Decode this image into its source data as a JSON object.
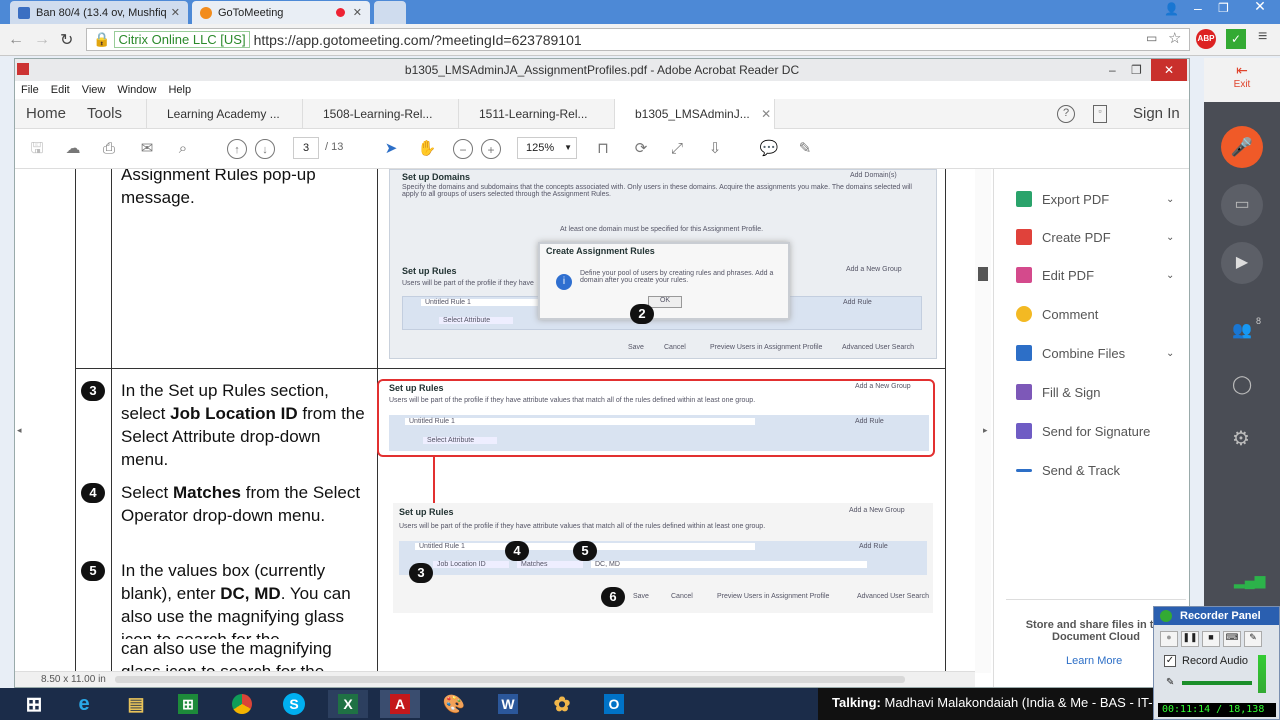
{
  "browser": {
    "tabs": [
      {
        "label": "Ban 80/4 (13.4 ov, Mushfiq"
      },
      {
        "label": "GoToMeeting"
      }
    ],
    "security_label": "Citrix Online LLC [US]",
    "url": "https://app.gotomeeting.com/?meetingId=623789101"
  },
  "acrobat": {
    "window_title": "b1305_LMSAdminJA_AssignmentProfiles.pdf - Adobe Acrobat Reader DC",
    "menu": [
      "File",
      "Edit",
      "View",
      "Window",
      "Help"
    ],
    "home_label": "Home",
    "tools_label": "Tools",
    "tabs": [
      "Learning Academy ...",
      "1508-Learning-Rel...",
      "1511-Learning-Rel...",
      "b1305_LMSAdminJ..."
    ],
    "sign_in": "Sign In",
    "page_current": "3",
    "page_total": "/ 13",
    "zoom": "125%",
    "page_size": "8.50 x 11.00 in"
  },
  "document": {
    "intro_text": "Assignment Rules pop-up message.",
    "step3_num": "3",
    "step3_a": "In the Set up Rules section, select ",
    "step3_b": "Job Location ID",
    "step3_c": " from the Select Attribute drop-down menu.",
    "step4_num": "4",
    "step4_a": "Select ",
    "step4_b": "Matches",
    "step4_c": " from the Select Operator drop-down menu.",
    "step5_num": "5",
    "step5_a": "In the values box (currently blank), enter ",
    "step5_b": "DC, MD",
    "step5_c": ". You can also use the magnifying glass icon to search for the",
    "step5_repeat": "can also use the magnifying glass icon to search for the",
    "shot1": {
      "domains_hdr": "Set up Domains",
      "add_domains": "Add Domain(s)",
      "domains_desc": "Specify the domains and subdomains that the concepts associated with. Only users in these domains. Acquire the assignments you make. The domains selected will apply to all groups of users selected through the Assignment Rules.",
      "domains_note": "At least one domain must be specified for this Assignment Profile.",
      "dialog_title": "Create Assignment Rules",
      "dialog_body": "Define your pool of users by creating rules and phrases. Add a domain after you create your rules.",
      "ok": "OK",
      "callout": "2",
      "rules_hdr": "Set up Rules",
      "rules_desc": "Users will be part of the profile if they have",
      "add_group": "Add a New Group",
      "rule1": "Untitled Rule 1",
      "add_rule": "Add Rule",
      "select_attr": "Select Attribute",
      "save": "Save",
      "cancel": "Cancel",
      "preview": "Preview Users in Assignment Profile",
      "advanced": "Advanced User Search"
    },
    "shot2": {
      "rules_hdr": "Set up Rules",
      "add_group": "Add a New Group",
      "rules_desc": "Users will be part of the profile if they have attribute values that match all of the rules defined within at least one group.",
      "rule1": "Untitled Rule 1",
      "add_rule": "Add Rule",
      "select_attr": "Select Attribute"
    },
    "shot3": {
      "rules_hdr": "Set up Rules",
      "add_group": "Add a New Group",
      "rules_desc": "Users will be part of the profile if they have attribute values that match all of the rules defined within at least one group.",
      "rule1": "Untitled Rule 1",
      "add_rule": "Add Rule",
      "attr": "Job Location ID",
      "op": "Matches",
      "val": "DC, MD",
      "save": "Save",
      "cancel": "Cancel",
      "preview": "Preview Users in Assignment Profile",
      "advanced": "Advanced User Search",
      "c3": "3",
      "c4": "4",
      "c5": "5",
      "c6": "6"
    }
  },
  "right_pane": {
    "items": [
      {
        "label": "Export PDF",
        "color": "#2aa36b"
      },
      {
        "label": "Create PDF",
        "color": "#e0423b"
      },
      {
        "label": "Edit PDF",
        "color": "#d44a8c"
      },
      {
        "label": "Comment",
        "color": "#f3b923"
      },
      {
        "label": "Combine Files",
        "color": "#2d6fc7"
      },
      {
        "label": "Fill & Sign",
        "color": "#7d58b8"
      },
      {
        "label": "Send for Signature",
        "color": "#6f5cc4"
      },
      {
        "label": "Send & Track",
        "color": "#2d6fc7"
      }
    ],
    "store_text": "Store and share files in the Document Cloud",
    "learn_more": "Learn More"
  },
  "g2m": {
    "exit": "Exit",
    "attendee_count": "8"
  },
  "talking": {
    "label": "Talking:",
    "name": "Madhavi Malakondaiah (India & Me - BAS - IT-"
  },
  "recorder": {
    "title": "Recorder Panel",
    "record_audio": "Record Audio",
    "timer": "00:11:14 / 18,138"
  },
  "taskbar": {
    "icons": [
      "windows-start",
      "internet-explorer",
      "file-explorer",
      "excel-green",
      "chrome",
      "skype",
      "excel",
      "acrobat",
      "paint",
      "word",
      "flower-app",
      "outlook"
    ]
  }
}
